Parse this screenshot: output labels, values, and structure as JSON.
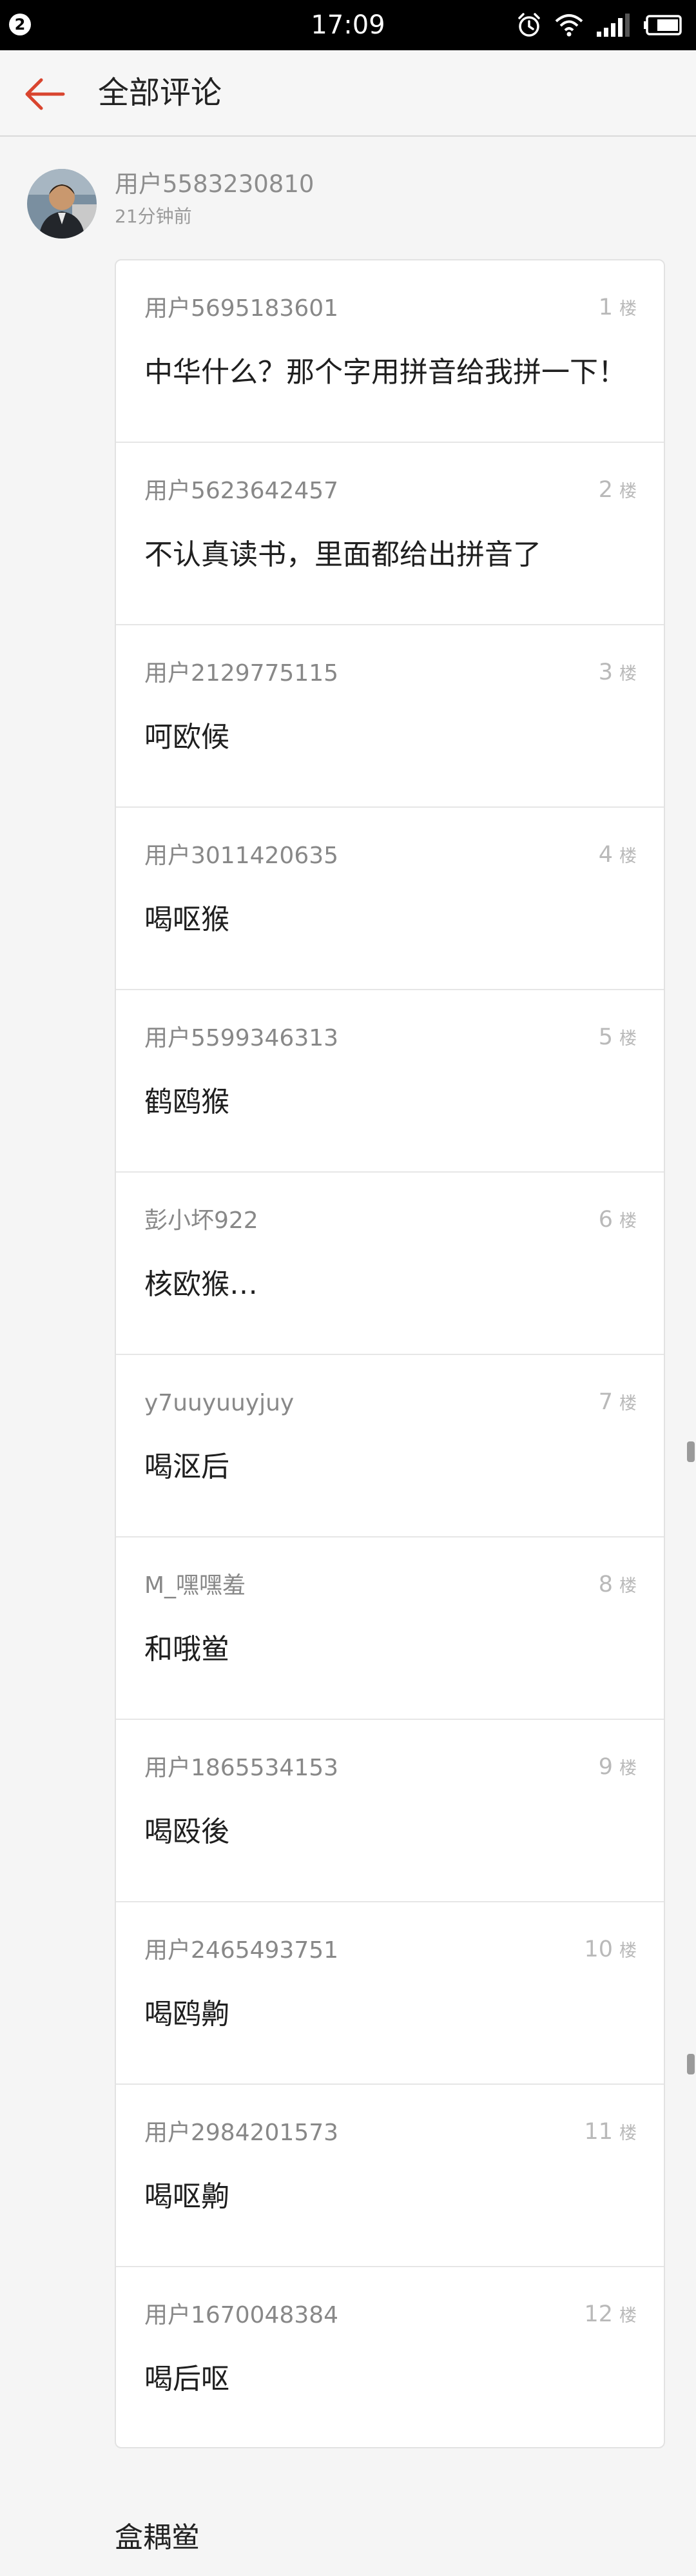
{
  "status_bar": {
    "badge": "2",
    "time": "17:09",
    "icons": [
      "alarm-icon",
      "wifi-icon",
      "signal-icon",
      "battery-icon"
    ]
  },
  "header": {
    "title": "全部评论",
    "back_icon": "arrow-left-icon",
    "accent_color": "#d9452f"
  },
  "post": {
    "user": "用户5583230810",
    "time": "21分钟前"
  },
  "floor_suffix": "楼",
  "replies": [
    {
      "user": "用户5695183601",
      "floor": "1",
      "text": "中华什么？那个字用拼音给我拼一下！"
    },
    {
      "user": "用户5623642457",
      "floor": "2",
      "text": "不认真读书，里面都给出拼音了"
    },
    {
      "user": "用户2129775115",
      "floor": "3",
      "text": "呵欧候"
    },
    {
      "user": "用户3011420635",
      "floor": "4",
      "text": "喝呕猴"
    },
    {
      "user": "用户5599346313",
      "floor": "5",
      "text": "鹤鸥猴"
    },
    {
      "user": "彭小坏922",
      "floor": "6",
      "text": "核欧猴…"
    },
    {
      "user": "y7uuyuuyjuy",
      "floor": "7",
      "text": "喝沤后"
    },
    {
      "user": "M_嘿嘿羞",
      "floor": "8",
      "text": "和哦鲎"
    },
    {
      "user": "用户1865534153",
      "floor": "9",
      "text": "喝殴後"
    },
    {
      "user": "用户2465493751",
      "floor": "10",
      "text": "喝鸥齁"
    },
    {
      "user": "用户2984201573",
      "floor": "11",
      "text": "喝呕齁"
    },
    {
      "user": "用户1670048384",
      "floor": "12",
      "text": "喝后呕"
    }
  ],
  "bottom_text": "盒耦鲎"
}
